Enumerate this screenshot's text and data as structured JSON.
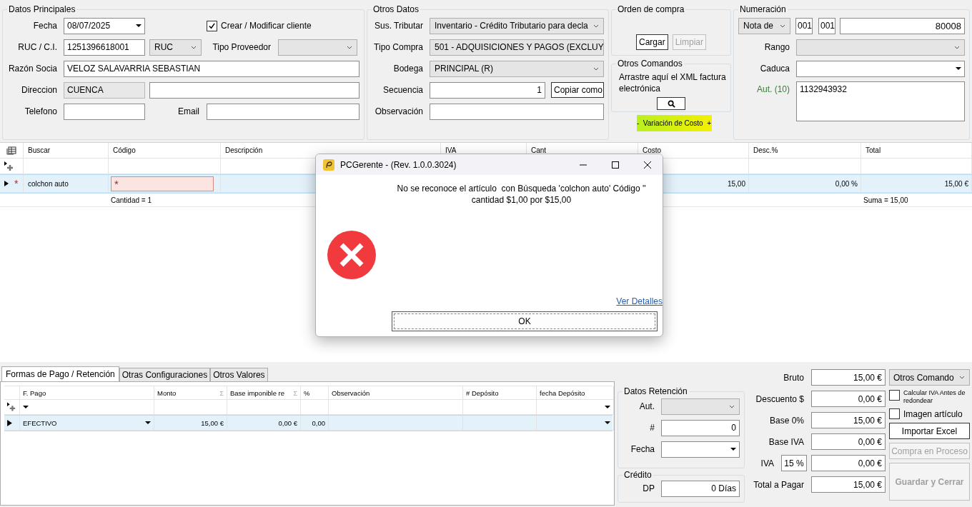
{
  "datos_principales": {
    "title": "Datos Principales",
    "fecha": {
      "label": "Fecha",
      "value": "08/07/2025"
    },
    "crear_cliente": {
      "label": "Crear / Modificar cliente",
      "checked": true
    },
    "ruc": {
      "label": "RUC / C.I.",
      "value": "1251396618001",
      "tipo": "RUC"
    },
    "tipo_proveedor": {
      "label": "Tipo Proveedor"
    },
    "razon_social": {
      "label": "Razón Socia",
      "value": "VELOZ  SALAVARRIA SEBASTIAN"
    },
    "direccion": {
      "label": "Direccion",
      "value": "CUENCA"
    },
    "telefono": {
      "label": "Telefono"
    },
    "email": {
      "label": "Email"
    }
  },
  "otros_datos": {
    "title": "Otros Datos",
    "sustento": {
      "label": "Sus. Tributar",
      "value": "Inventario - Crédito Tributario para decla"
    },
    "tipo_compra": {
      "label": "Tipo Compra",
      "value": "501 - ADQUISICIONES Y PAGOS (EXCLUY"
    },
    "bodega": {
      "label": "Bodega",
      "value": "PRINCIPAL (R)"
    },
    "secuencia": {
      "label": "Secuencia",
      "value": "1"
    },
    "copiar_button": "Copiar como",
    "observacion": {
      "label": "Observación"
    }
  },
  "orden_compra": {
    "title": "Orden de compra",
    "buttons": [
      {
        "label": "Cargar",
        "disabled": false
      },
      {
        "label": "Limpiar",
        "disabled": true
      }
    ]
  },
  "otros_comandos": {
    "title": "Otros Comandos",
    "drop_hint": "Arrastre aquí el XML factura electrónica"
  },
  "variacion_costo": "-  Variación de Costo  +",
  "numeracion": {
    "title": "Numeración",
    "tipo": "Nota de",
    "serie_1": "001",
    "serie_2": "001",
    "numero": "80008",
    "rango": {
      "label": "Rango"
    },
    "caduca": {
      "label": "Caduca"
    },
    "autorizacion": {
      "label": "Aut. (10)",
      "value": "1132943932"
    }
  },
  "items_grid": {
    "columns": [
      "Buscar",
      "Código",
      "Descripción",
      "IVA",
      "Cant",
      "Costo",
      "Desc.%",
      "Total"
    ],
    "rows": [
      {
        "marker": "*",
        "buscar": "colchon auto",
        "codigo": "*",
        "costo": "15,00",
        "descuento": "0,00 %",
        "total": "15,00 €",
        "selected": true
      }
    ],
    "summary": {
      "cantidad": "Cantidad = 1",
      "suma": "Suma = 15,00"
    }
  },
  "bottom_tabs": [
    {
      "label": "Formas de Pago / Retención",
      "selected": true
    },
    {
      "label": "Otras Configuraciones",
      "selected": false
    },
    {
      "label": "Otros Valores",
      "selected": false
    }
  ],
  "pagos_grid": {
    "columns": [
      {
        "label": "F. Pago"
      },
      {
        "label": "Monto",
        "sum_mark": "Σ"
      },
      {
        "label": "Base imponible re",
        "sum_mark": "Σ"
      },
      {
        "label": "%"
      },
      {
        "label": "Observación"
      },
      {
        "label": "# Depósito"
      },
      {
        "label": "fecha Depósito"
      }
    ],
    "rows": [
      {
        "forma": "EFECTIVO",
        "monto": "15,00 €",
        "base": "0,00 €",
        "porcentaje": "0,00",
        "selected": true
      }
    ]
  },
  "datos_retencion": {
    "title": "Datos Retención",
    "aut": {
      "label": "Aut."
    },
    "numero": {
      "label": "#",
      "value": "0"
    },
    "fecha": {
      "label": "Fecha"
    }
  },
  "credito": {
    "title": "Crédito",
    "dp": {
      "label": "DP",
      "value": "0 Días"
    }
  },
  "totales": [
    {
      "label": "Bruto",
      "value": "15,00 €"
    },
    {
      "label": "Descuento $",
      "value": "0,00 €"
    },
    {
      "label": "Base 0%",
      "value": "15,00 €"
    },
    {
      "label": "Base IVA",
      "value": "0,00 €"
    },
    {
      "label": "IVA",
      "rate": "15 %",
      "value": "0,00 €"
    },
    {
      "label": "Total a Pagar",
      "value": "15,00 €"
    }
  ],
  "comandos": {
    "otros": "Otros Comando",
    "calcular_iva": {
      "label": "Calcular IVA Antes de redondear",
      "checked": false
    },
    "imagen": {
      "label": "Imagen artículo",
      "checked": false
    },
    "importar": {
      "label": "Importar Excel",
      "disabled": false
    },
    "compra_proceso": {
      "label": "Compra en Proceso",
      "disabled": true
    },
    "guardar": {
      "label": "Guardar y Cerrar",
      "disabled": true
    }
  },
  "dialog": {
    "title": "PCGerente - (Rev. 1.0.0.3024)",
    "message": "No se reconoce el artículo  con Búsqueda 'colchon auto' Código ''\ncantidad $1,00 por $15,00",
    "details_link": "Ver Detalles",
    "ok": "OK"
  }
}
